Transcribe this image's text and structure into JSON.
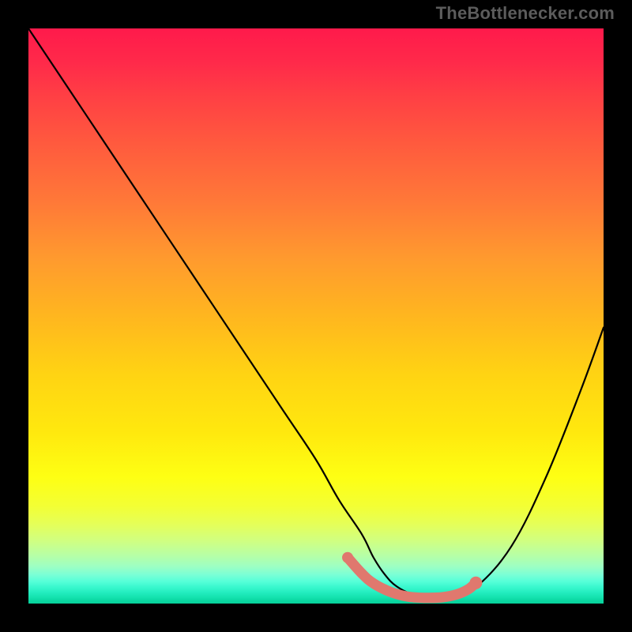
{
  "attribution": "TheBottlenecker.com",
  "chart_data": {
    "type": "line",
    "title": "",
    "xlabel": "",
    "ylabel": "",
    "xlim": [
      0,
      100
    ],
    "ylim": [
      0,
      100
    ],
    "series": [
      {
        "name": "bottleneck-curve",
        "x": [
          0,
          10,
          20,
          28,
          36,
          44,
          50,
          54,
          58,
          60,
          62,
          64,
          67,
          70,
          72,
          74,
          78,
          84,
          90,
          96,
          100
        ],
        "y": [
          100,
          85,
          70,
          58,
          46,
          34,
          25,
          18,
          12,
          8,
          5,
          3,
          1.5,
          1,
          1,
          1.2,
          3,
          10,
          22,
          37,
          48
        ]
      }
    ],
    "highlight_segment": {
      "name": "optimal-range",
      "color": "#e0786e",
      "points": [
        {
          "x": 55.5,
          "y": 8.0
        },
        {
          "x": 58.0,
          "y": 5.2
        },
        {
          "x": 60.0,
          "y": 3.5
        },
        {
          "x": 63.0,
          "y": 2.0
        },
        {
          "x": 66.0,
          "y": 1.2
        },
        {
          "x": 69.0,
          "y": 1.0
        },
        {
          "x": 72.0,
          "y": 1.1
        },
        {
          "x": 74.5,
          "y": 1.6
        },
        {
          "x": 76.5,
          "y": 2.5
        },
        {
          "x": 77.8,
          "y": 3.6
        }
      ]
    },
    "gradient": {
      "top_color": "#ff1a4b",
      "mid_color": "#ffe80e",
      "bottom_color": "#07d09a"
    }
  }
}
